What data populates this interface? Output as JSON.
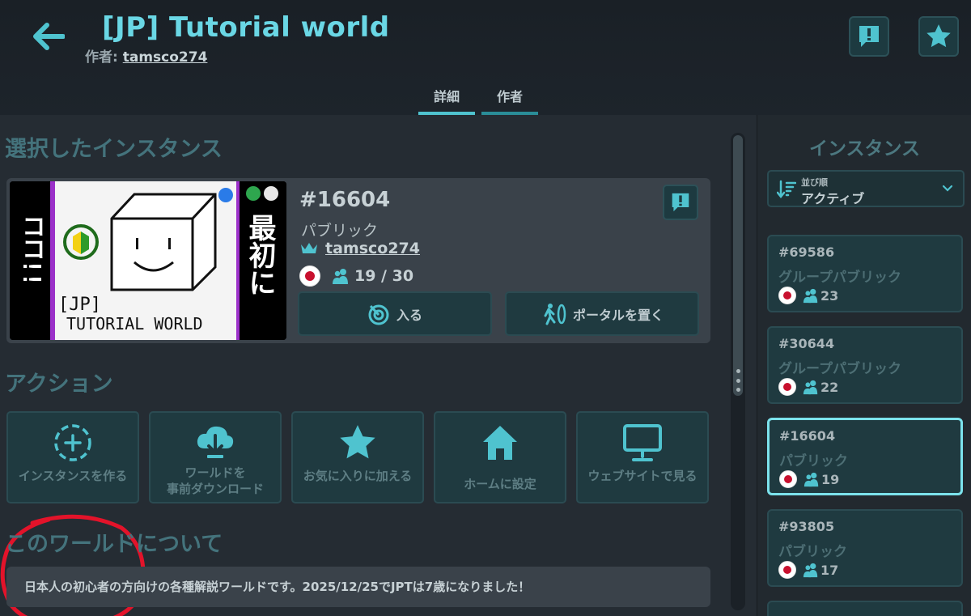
{
  "header": {
    "title": "[JP] Tutorial world",
    "author_label": "作者: ",
    "author_name": "tamsco274",
    "tabs": [
      {
        "label": "詳細",
        "active": true
      },
      {
        "label": "作者",
        "active": false
      }
    ]
  },
  "selected_section_title": "選択したインスタンス",
  "selected_instance": {
    "number": "#16604",
    "type": "パブリック",
    "owner": "tamsco274",
    "players": "19 / 30",
    "join_label": "入る",
    "portal_label": "ポータルを置く"
  },
  "thumbnail": {
    "left_text": "ココ!!",
    "right_text": "最初に",
    "caption_line1": "[JP]",
    "caption_line2": "TUTORIAL WORLD"
  },
  "actions_title": "アクション",
  "actions": [
    {
      "label": "インスタンスを作る",
      "icon": "plus-circle-icon"
    },
    {
      "label": "ワールドを\n事前ダウンロード",
      "icon": "cloud-download-icon"
    },
    {
      "label": "お気に入りに加える",
      "icon": "star-icon"
    },
    {
      "label": "ホームに設定",
      "icon": "home-icon"
    },
    {
      "label": "ウェブサイトで見る",
      "icon": "monitor-icon"
    }
  ],
  "about": {
    "title": "このワールドについて",
    "description": "日本人の初心者の方向けの各種解説ワールドです。2025/12/25でJPTは7歳になりました！"
  },
  "sidebar": {
    "title": "インスタンス",
    "sort_label": "並び順",
    "sort_value": "アクティブ",
    "instances": [
      {
        "number": "#69586",
        "type": "グループパブリック",
        "count": "23",
        "selected": false
      },
      {
        "number": "#30644",
        "type": "グループパブリック",
        "count": "22",
        "selected": false
      },
      {
        "number": "#16604",
        "type": "パブリック",
        "count": "19",
        "selected": true
      },
      {
        "number": "#93805",
        "type": "パブリック",
        "count": "17",
        "selected": false
      }
    ]
  },
  "colors": {
    "accent": "#4fc3cf",
    "title": "#6ad7e5",
    "button_bg": "#1f3a40",
    "annotation": "#e3132a"
  }
}
